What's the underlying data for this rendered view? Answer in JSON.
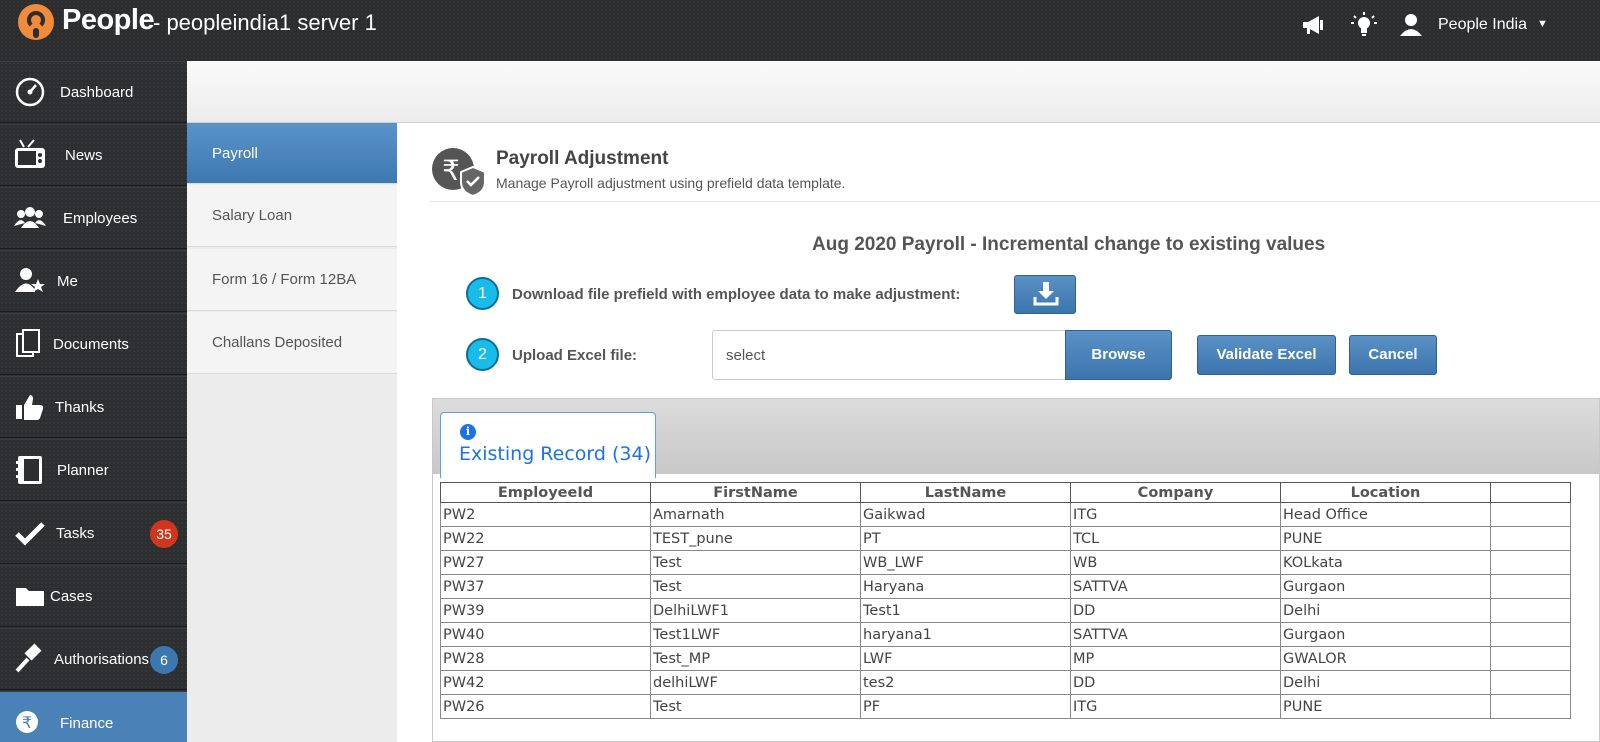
{
  "topbar": {
    "app_name": "People",
    "server_name": "- peopleindia1 server 1",
    "user_name": "People India",
    "icons": [
      "megaphone-icon",
      "lightbulb-icon",
      "user-icon",
      "caret-down-icon"
    ]
  },
  "sidebar": {
    "items": [
      {
        "label": "Dashboard",
        "icon": "dashboard-icon"
      },
      {
        "label": "News",
        "icon": "tv-icon"
      },
      {
        "label": "Employees",
        "icon": "group-icon"
      },
      {
        "label": "Me",
        "icon": "user-star-icon"
      },
      {
        "label": "Documents",
        "icon": "documents-icon"
      },
      {
        "label": "Thanks",
        "icon": "thumbs-up-icon"
      },
      {
        "label": "Planner",
        "icon": "planner-icon"
      },
      {
        "label": "Tasks",
        "icon": "checkmark-icon",
        "badge": "35"
      },
      {
        "label": "Cases",
        "icon": "folder-icon"
      },
      {
        "label": "Authorisations",
        "icon": "gavel-icon",
        "badge": "6"
      },
      {
        "label": "Finance",
        "icon": "rupee-icon"
      }
    ]
  },
  "submenu": {
    "items": [
      {
        "label": "Payroll"
      },
      {
        "label": "Salary Loan"
      },
      {
        "label": "Form 16 / Form 12BA"
      },
      {
        "label": "Challans Deposited"
      }
    ]
  },
  "main": {
    "title": "Payroll Adjustment",
    "subtitle": "Manage Payroll adjustment using prefield data template.",
    "section_title": "Aug 2020 Payroll - Incremental change to existing values",
    "step1": {
      "number": "1",
      "label": "Download file prefield with employee data to make adjustment:"
    },
    "step2": {
      "number": "2",
      "label": "Upload Excel file:"
    },
    "upload_value": "select",
    "browse_label": "Browse",
    "validate_label": "Validate Excel",
    "cancel_label": "Cancel",
    "tab_label": "Existing Record (34)",
    "table": {
      "columns": [
        "EmployeeId",
        "FirstName",
        "LastName",
        "Company",
        "Location",
        ""
      ],
      "rows": [
        [
          "PW2",
          "Amarnath",
          "Gaikwad",
          "ITG",
          "Head Office",
          ""
        ],
        [
          "PW22",
          "TEST_pune",
          "PT",
          "TCL",
          "PUNE",
          ""
        ],
        [
          "PW27",
          "Test",
          "WB_LWF",
          "WB",
          "KOLkata",
          ""
        ],
        [
          "PW37",
          "Test",
          "Haryana",
          "SATTVA",
          "Gurgaon",
          ""
        ],
        [
          "PW39",
          "DelhiLWF1",
          "Test1",
          "DD",
          "Delhi",
          ""
        ],
        [
          "PW40",
          "Test1LWF",
          "haryana1",
          "SATTVA",
          "Gurgaon",
          ""
        ],
        [
          "PW28",
          "Test_MP",
          "LWF",
          "MP",
          "GWALOR",
          ""
        ],
        [
          "PW42",
          "delhiLWF",
          "tes2",
          "DD",
          "Delhi",
          ""
        ],
        [
          "PW26",
          "Test",
          "PF",
          "ITG",
          "PUNE",
          ""
        ]
      ]
    }
  }
}
